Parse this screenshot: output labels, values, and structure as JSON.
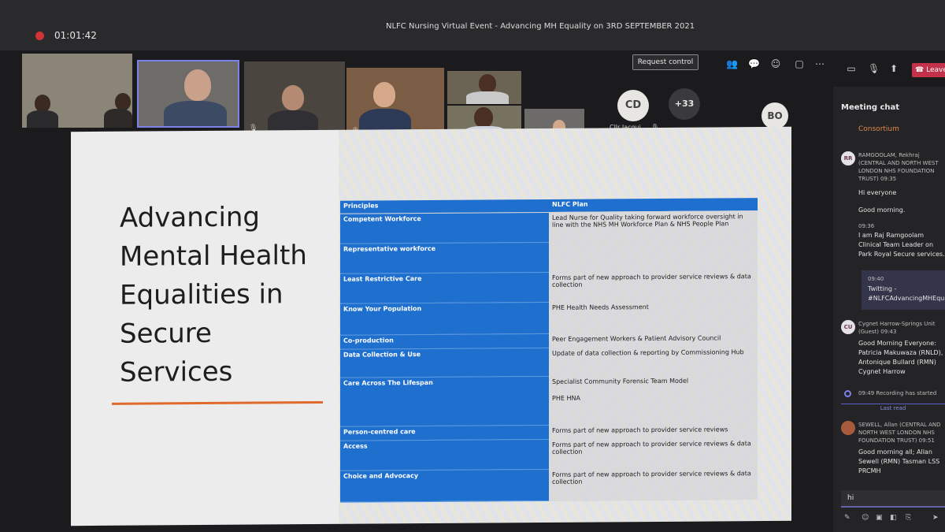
{
  "window": {
    "timer": "01:01:42",
    "title": "NLFC Nursing Virtual Event - Advancing MH Equality on 3RD SEPTEMBER 2021"
  },
  "controls": {
    "request_control": "Request control",
    "leave": "Leave",
    "icons": [
      "people-icon",
      "chat-icon",
      "reactions-icon",
      "rooms-icon",
      "more-icon",
      "camera-icon",
      "mic-icon",
      "share-icon",
      "leave-phone-icon"
    ]
  },
  "participants": {
    "cd_initials": "CD",
    "cd_name": "Cllr Jacqui ...",
    "overflow_count": "+33",
    "bo_initials": "BO"
  },
  "slide": {
    "title_lines": [
      "Advancing",
      "Mental Health",
      "Equalities in",
      "Secure",
      "Services"
    ],
    "table": {
      "headers": [
        "Principles",
        "NLFC Plan"
      ],
      "rows": [
        {
          "principle": "Competent Workforce",
          "plan": "Lead Nurse for Quality taking forward workforce oversight in line with the NHS MH Workforce Plan & NHS People Plan"
        },
        {
          "principle": "Representative workforce",
          "plan": ""
        },
        {
          "principle": "Least Restrictive Care",
          "plan": "Forms part of new approach to provider service reviews & data collection"
        },
        {
          "principle": "Know Your Population",
          "plan": "PHE Health Needs Assessment"
        },
        {
          "principle": "Co-production",
          "plan": "Peer Engagement Workers & Patient Advisory Council"
        },
        {
          "principle": "Data Collection & Use",
          "plan": "Update of data collection & reporting by Commissioning Hub"
        },
        {
          "principle": "Care Across The Lifespan",
          "plan": "Specialist Community Forensic Team Model",
          "plan2": "PHE HNA"
        },
        {
          "principle": "Person-centred care",
          "plan": "Forms part of new approach to provider service reviews"
        },
        {
          "principle": "Access",
          "plan": "Forms part of new approach to provider service reviews & data collection"
        },
        {
          "principle": "Choice and Advocacy",
          "plan": "Forms part of new approach to provider service reviews & data collection"
        }
      ]
    }
  },
  "chat": {
    "title": "Meeting chat",
    "consortium": "Consortium",
    "messages": [
      {
        "initials": "RR",
        "sender": "RAMGOOLAM, Rekhraj (CENTRAL AND NORTH WEST LONDON NHS FOUNDATION TRUST)",
        "time": "09:35",
        "lines": [
          "Hi everyone",
          "Good morning."
        ]
      },
      {
        "time": "09:36",
        "lines": [
          "I am Raj Ramgoolam Clinical Team Leader on Park Royal Secure services."
        ]
      },
      {
        "time": "09:40",
        "lines": [
          "Twitting -",
          "#NLFCAdvancingMHEquali"
        ]
      },
      {
        "initials": "CU",
        "sender": "Cygnet Harrow-Springs Unit (Guest)",
        "time": "09:43",
        "lines": [
          "Good Morning Everyone: Patricia Makuwaza (RNLD), Antonique Bullard (RMN) Cygnet Harrow"
        ]
      },
      {
        "time": "09:49",
        "lines": [
          "Recording has started"
        ]
      },
      {
        "sender": "SEWELL, Allan (CENTRAL AND NORTH WEST LONDON NHS FOUNDATION TRUST)",
        "time": "09:51",
        "lines": [
          "Good morning all; Allan Sewell (RMN) Tasman LSS PRCMH"
        ]
      }
    ],
    "last_read": "Last read",
    "input_value": "hi"
  }
}
